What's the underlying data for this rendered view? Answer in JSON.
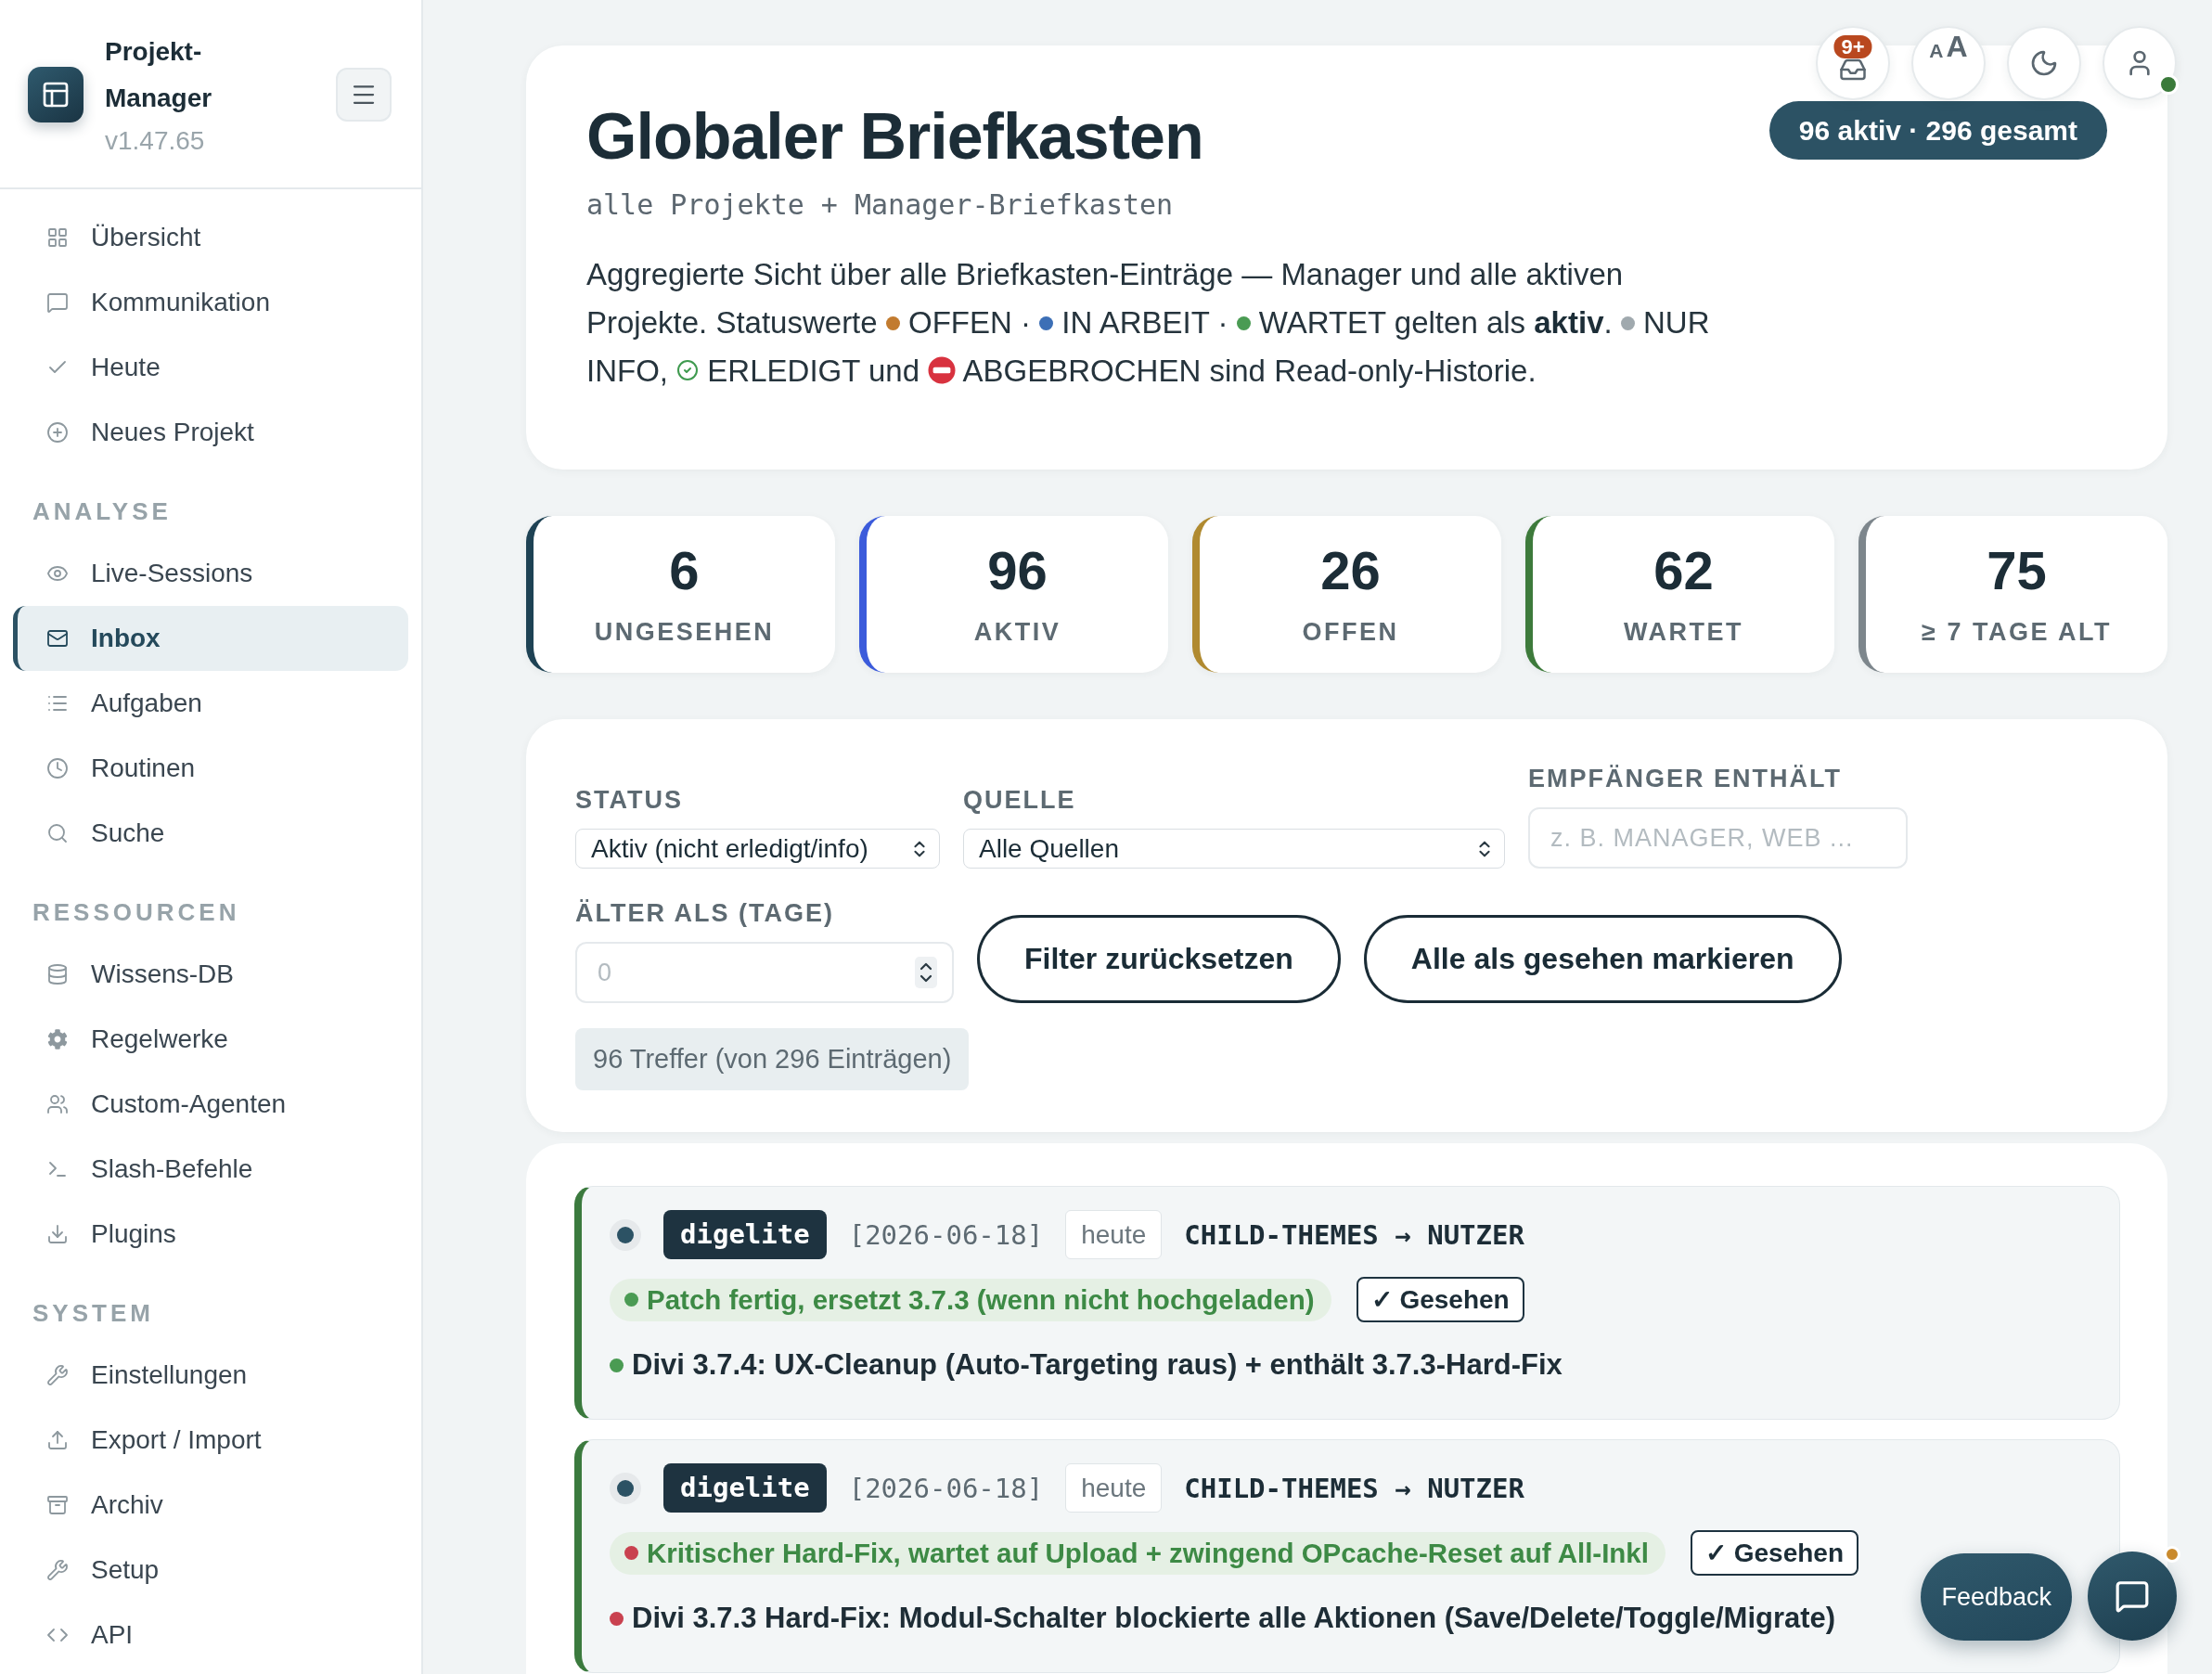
{
  "sidebar": {
    "app_name": "Projekt-Manager",
    "version": "v1.47.65",
    "nav": [
      {
        "label": "Übersicht",
        "selected": false
      },
      {
        "label": "Kommunikation",
        "selected": false
      },
      {
        "label": "Heute",
        "selected": false
      },
      {
        "label": "Neues Projekt",
        "selected": false
      }
    ],
    "sections": [
      {
        "title": "ANALYSE",
        "items": [
          {
            "label": "Live-Sessions",
            "selected": false
          },
          {
            "label": "Inbox",
            "selected": true
          },
          {
            "label": "Aufgaben",
            "selected": false
          },
          {
            "label": "Routinen",
            "selected": false
          },
          {
            "label": "Suche",
            "selected": false
          }
        ]
      },
      {
        "title": "RESSOURCEN",
        "items": [
          {
            "label": "Wissens-DB",
            "selected": false
          },
          {
            "label": "Regelwerke",
            "selected": false
          },
          {
            "label": "Custom-Agenten",
            "selected": false
          },
          {
            "label": "Slash-Befehle",
            "selected": false
          },
          {
            "label": "Plugins",
            "selected": false
          }
        ]
      },
      {
        "title": "SYSTEM",
        "items": [
          {
            "label": "Einstellungen",
            "selected": false
          },
          {
            "label": "Export / Import",
            "selected": false
          },
          {
            "label": "Archiv",
            "selected": false
          },
          {
            "label": "Setup",
            "selected": false
          },
          {
            "label": "API",
            "selected": false
          }
        ]
      }
    ]
  },
  "toolbar": {
    "inbox_badge": "9+",
    "text_size": [
      "A",
      "A"
    ],
    "user_online": true
  },
  "header": {
    "title": "Globaler Briefkasten",
    "subtitle": "alle Projekte + Manager-Briefkasten",
    "summary": "96 aktiv · 296 gesamt",
    "description": [
      {
        "kind": "text",
        "text": "Aggregierte Sicht über alle Briefkasten-Einträge — Manager und alle aktiven Projekte. Statuswerte "
      },
      {
        "kind": "dot",
        "color": "#c27b2f"
      },
      {
        "kind": "text",
        "text": " OFFEN · "
      },
      {
        "kind": "dot",
        "color": "#3c6fb6"
      },
      {
        "kind": "text",
        "text": " IN ARBEIT · "
      },
      {
        "kind": "dot",
        "color": "#4a9b53"
      },
      {
        "kind": "text",
        "text": " WARTET gelten als **aktiv**. "
      },
      {
        "kind": "dot",
        "color": "#a0a9ae"
      },
      {
        "kind": "text",
        "text": " NUR INFO, "
      },
      {
        "kind": "check"
      },
      {
        "kind": "text",
        "text": " ERLEDIGT und "
      },
      {
        "kind": "stop"
      },
      {
        "kind": "text",
        "text": " ABGEBROCHEN sind Read-only-Historie."
      }
    ]
  },
  "stats": [
    {
      "value": "6",
      "label": "UNGESEHEN",
      "color": "#1e4254"
    },
    {
      "value": "96",
      "label": "AKTIV",
      "color": "#3b5bdb"
    },
    {
      "value": "26",
      "label": "OFFEN",
      "color": "#b08a30"
    },
    {
      "value": "62",
      "label": "WARTET",
      "color": "#3d7a3b"
    },
    {
      "value": "75",
      "label": "≥ 7 TAGE ALT",
      "color": "#7d868c"
    }
  ],
  "filters": {
    "status": {
      "label": "STATUS",
      "value": "Aktiv (nicht erledigt/info)"
    },
    "source": {
      "label": "QUELLE",
      "value": "Alle Quellen"
    },
    "recipient": {
      "label": "EMPFÄNGER ENTHÄLT",
      "placeholder": "z. B. MANAGER, WEB ..."
    },
    "age": {
      "label": "ÄLTER ALS (TAGE)",
      "placeholder": "0"
    },
    "buttons": [
      "Filter zurücksetzen",
      "Alle als gesehen markieren"
    ],
    "result_count": "96 Treffer (von 296 Einträgen)"
  },
  "entries": [
    {
      "source": "digelite",
      "date": "[2026-06-18]",
      "age": "heute",
      "route": "CHILD-THEMES → NUTZER",
      "status": {
        "text": "Patch fertig, ersetzt 3.7.3 (wenn nicht hochgeladen)",
        "color": "#4a9b53"
      },
      "seen_button": "✓ Gesehen",
      "subject": {
        "text": "Divi 3.7.4: UX-Cleanup (Auto-Targeting raus) + enthält 3.7.3-Hard-Fix",
        "color": "#4a9b53"
      }
    },
    {
      "source": "digelite",
      "date": "[2026-06-18]",
      "age": "heute",
      "route": "CHILD-THEMES → NUTZER",
      "status": {
        "text": "Kritischer Hard-Fix, wartet auf Upload + zwingend OPcache-Reset auf All-Inkl",
        "color": "#c9414f"
      },
      "seen_button": "✓ Gesehen",
      "subject": {
        "text": "Divi 3.7.3 Hard-Fix: Modul-Schalter blockierte alle Aktionen (Save/Delete/Toggle/Migrate)",
        "color": "#c9414f"
      }
    }
  ],
  "floating": {
    "feedback": "Feedback",
    "chat_unread": true
  }
}
